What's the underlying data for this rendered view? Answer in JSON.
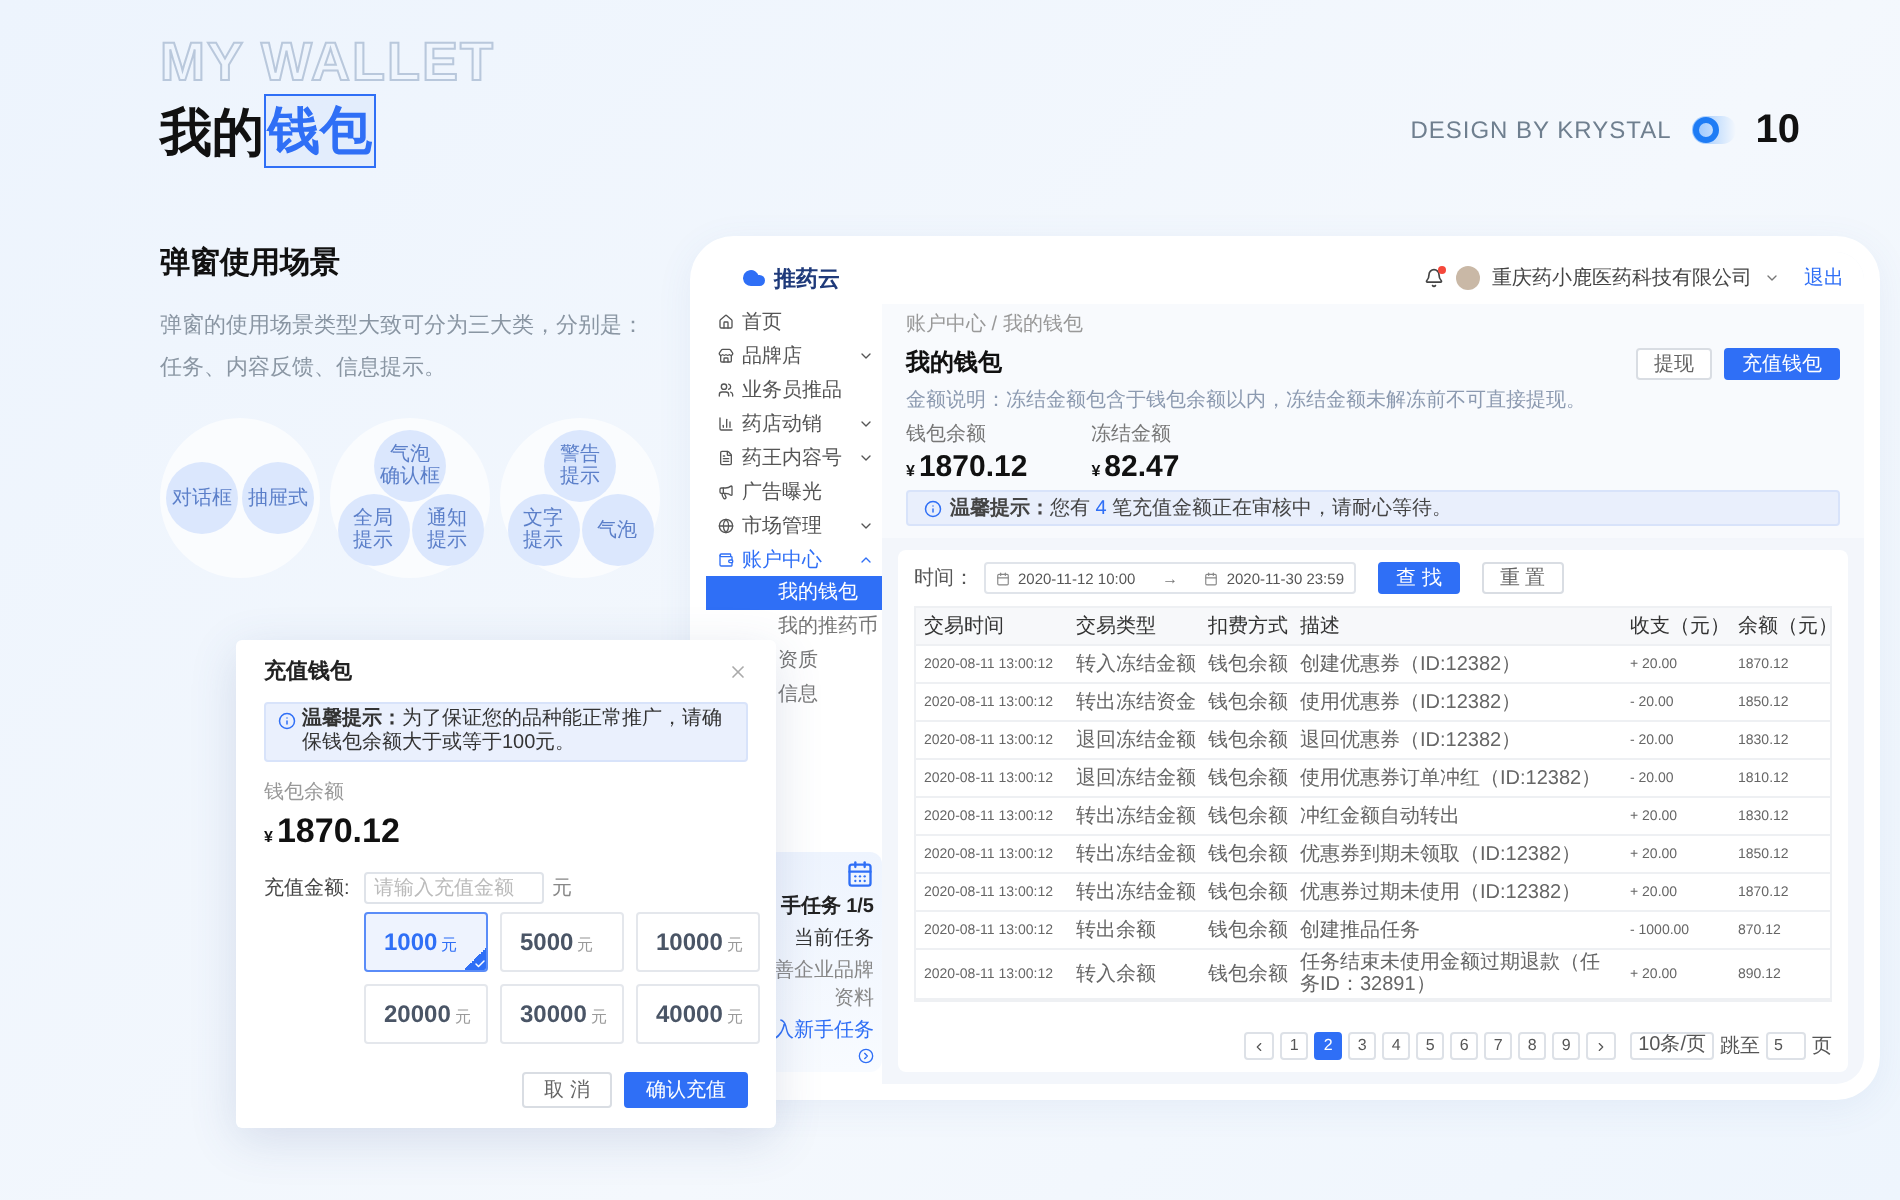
{
  "slide": {
    "bg_title": "MY WALLET",
    "title": "我的",
    "title_highlight": "钱包",
    "credit": "DESIGN BY KRYSTAL",
    "page_number": "10"
  },
  "section": {
    "heading": "弹窗使用场景",
    "description": "弹窗的使用场景类型大致可分为三大类，分别是：任务、内容反馈、信息提示。",
    "groups": [
      {
        "items": [
          {
            "lines": [
              "对话框"
            ]
          },
          {
            "lines": [
              "抽屉式"
            ]
          }
        ]
      },
      {
        "items": [
          {
            "lines": [
              "气泡",
              "确认框"
            ]
          },
          {
            "lines": [
              "全局",
              "提示"
            ]
          },
          {
            "lines": [
              "通知",
              "提示"
            ]
          }
        ]
      },
      {
        "items": [
          {
            "lines": [
              "警告",
              "提示"
            ]
          },
          {
            "lines": [
              "文字",
              "提示"
            ]
          },
          {
            "lines": [
              "气泡"
            ]
          }
        ]
      }
    ]
  },
  "app": {
    "logo": "推药云",
    "sidebar": {
      "items": [
        {
          "label": "首页",
          "kind": "link",
          "selected": false
        },
        {
          "label": "品牌店",
          "kind": "group",
          "expanded": false,
          "selected": false
        },
        {
          "label": "业务员推品",
          "kind": "link",
          "selected": false
        },
        {
          "label": "药店动销",
          "kind": "group",
          "expanded": false,
          "selected": false
        },
        {
          "label": "药王内容号",
          "kind": "group",
          "expanded": false,
          "selected": false
        },
        {
          "label": "广告曝光",
          "kind": "link",
          "selected": false
        },
        {
          "label": "市场管理",
          "kind": "group",
          "expanded": false,
          "selected": false
        },
        {
          "label": "账户中心",
          "kind": "group",
          "expanded": true,
          "selected": true,
          "children": [
            {
              "label": "我的钱包",
              "selected": true
            },
            {
              "label": "我的推药币",
              "selected": false
            },
            {
              "label": "资质",
              "selected": false
            },
            {
              "label": "信息",
              "selected": false
            }
          ]
        }
      ]
    },
    "task_card": {
      "title": "手任务",
      "progress": "1/5",
      "subtitle": "当前任务",
      "detail": "善企业品牌资料",
      "link": "入新手任务"
    },
    "header": {
      "has_unread": true,
      "company": "重庆药小鹿医药科技有限公司",
      "logout": "退出"
    },
    "breadcrumb": "账户中心 / 我的钱包",
    "title": "我的钱包",
    "actions": [
      {
        "label": "提现",
        "kind": "secondary"
      },
      {
        "label": "充值钱包",
        "kind": "primary"
      }
    ],
    "note": "金额说明：冻结金额包含于钱包余额以内，冻结金额未解冻前不可直接提现。",
    "stats": [
      {
        "label": "钱包余额",
        "currency": "¥",
        "value": "1870.12"
      },
      {
        "label": "冻结金额",
        "currency": "¥",
        "value": "82.47"
      }
    ],
    "notice": {
      "label": "温馨提示：",
      "before": "您有 ",
      "count": "4",
      "after": " 笔充值金额正在审核中，请耐心等待。"
    },
    "filter": {
      "label": "时间：",
      "start": "2020-11-12 10:00",
      "arrow": "→",
      "end": "2020-11-30 23:59",
      "search": "查 找",
      "reset": "重 置"
    },
    "table": {
      "columns": [
        "交易时间",
        "交易类型",
        "扣费方式",
        "描述",
        "收支（元）",
        "余额（元）"
      ],
      "rows": [
        [
          "2020-08-11 13:00:12",
          "转入冻结金额",
          "钱包余额",
          "创建优惠券（ID:12382）",
          "+ 20.00",
          "1870.12"
        ],
        [
          "2020-08-11 13:00:12",
          "转出冻结资金",
          "钱包余额",
          "使用优惠券（ID:12382）",
          "- 20.00",
          "1850.12"
        ],
        [
          "2020-08-11 13:00:12",
          "退回冻结金额",
          "钱包余额",
          "退回优惠券（ID:12382）",
          "- 20.00",
          "1830.12"
        ],
        [
          "2020-08-11 13:00:12",
          "退回冻结金额",
          "钱包余额",
          "使用优惠券订单冲红（ID:12382）",
          "- 20.00",
          "1810.12"
        ],
        [
          "2020-08-11 13:00:12",
          "转出冻结金额",
          "钱包余额",
          "冲红金额自动转出",
          "+ 20.00",
          "1830.12"
        ],
        [
          "2020-08-11 13:00:12",
          "转出冻结金额",
          "钱包余额",
          "优惠券到期未领取（ID:12382）",
          "+ 20.00",
          "1850.12"
        ],
        [
          "2020-08-11 13:00:12",
          "转出冻结金额",
          "钱包余额",
          "优惠券过期未使用（ID:12382）",
          "+ 20.00",
          "1870.12"
        ],
        [
          "2020-08-11 13:00:12",
          "转出余额",
          "钱包余额",
          "创建推品任务",
          "- 1000.00",
          "870.12"
        ],
        [
          "2020-08-11 13:00:12",
          "转入余额",
          "钱包余额",
          "任务结束未使用金额过期退款（任务ID：32891）",
          "+ 20.00",
          "890.12"
        ]
      ]
    },
    "pagination": {
      "pages": [
        {
          "label": "1",
          "selected": false
        },
        {
          "label": "2",
          "selected": true
        },
        {
          "label": "3",
          "selected": false
        },
        {
          "label": "4",
          "selected": false
        },
        {
          "label": "5",
          "selected": false
        },
        {
          "label": "6",
          "selected": false
        },
        {
          "label": "7",
          "selected": false
        },
        {
          "label": "8",
          "selected": false
        },
        {
          "label": "9",
          "selected": false
        }
      ],
      "page_size": "10条/页",
      "jump_label": "跳至",
      "jump_value": "5",
      "jump_suffix": "页"
    }
  },
  "dialog": {
    "title": "充值钱包",
    "notice": "**温馨提示：**为了保证您的品种能正常推广，请确保钱包余额大于或等于100元。",
    "balance_label": "钱包余额",
    "currency": "¥",
    "balance": "1870.12",
    "amount_label": "充值金额:",
    "amount_placeholder": "请输入充值金额",
    "unit": "元",
    "options": [
      {
        "amount": "1000",
        "unit": "元",
        "selected": true
      },
      {
        "amount": "5000",
        "unit": "元",
        "selected": false
      },
      {
        "amount": "10000",
        "unit": "元",
        "selected": false
      },
      {
        "amount": "20000",
        "unit": "元",
        "selected": false
      },
      {
        "amount": "30000",
        "unit": "元",
        "selected": false
      },
      {
        "amount": "40000",
        "unit": "元",
        "selected": false
      }
    ],
    "buttons": [
      {
        "label": "取 消",
        "kind": "secondary"
      },
      {
        "label": "确认充值",
        "kind": "primary"
      }
    ]
  }
}
